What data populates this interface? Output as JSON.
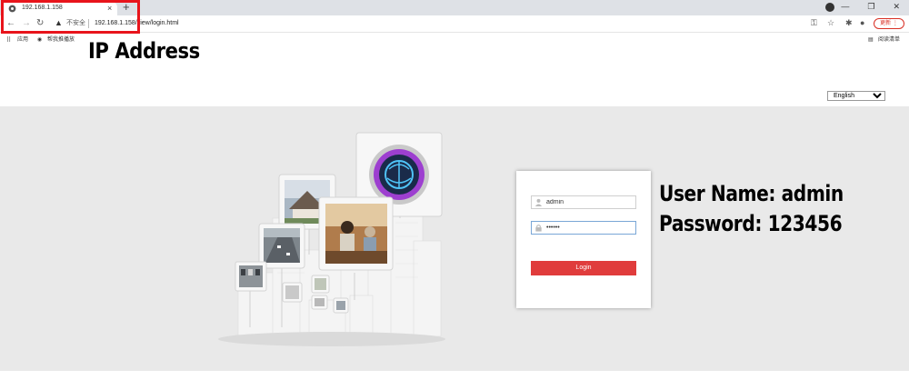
{
  "browser": {
    "tab_title": "192.168.1.158",
    "tab_close": "×",
    "new_tab": "+",
    "insecure_label": "不安全",
    "url": "192.168.1.158/view/login.html",
    "update_label": "更新",
    "bookmarks": {
      "apps": "应用",
      "item": "帮我推播放",
      "reading_list": "阅读清单"
    }
  },
  "page": {
    "language": {
      "selected": "English",
      "options": [
        "English"
      ]
    },
    "login": {
      "username_value": "admin",
      "password_value": "123456",
      "login_label": "Login"
    }
  },
  "overlay": {
    "ip_label": "IP Address",
    "username_label": "User Name: admin",
    "password_label": "Password: 123456"
  },
  "colors": {
    "accent_red": "#e8141b",
    "login_button": "#e03c3c",
    "background_gray": "#e9e9e9"
  }
}
